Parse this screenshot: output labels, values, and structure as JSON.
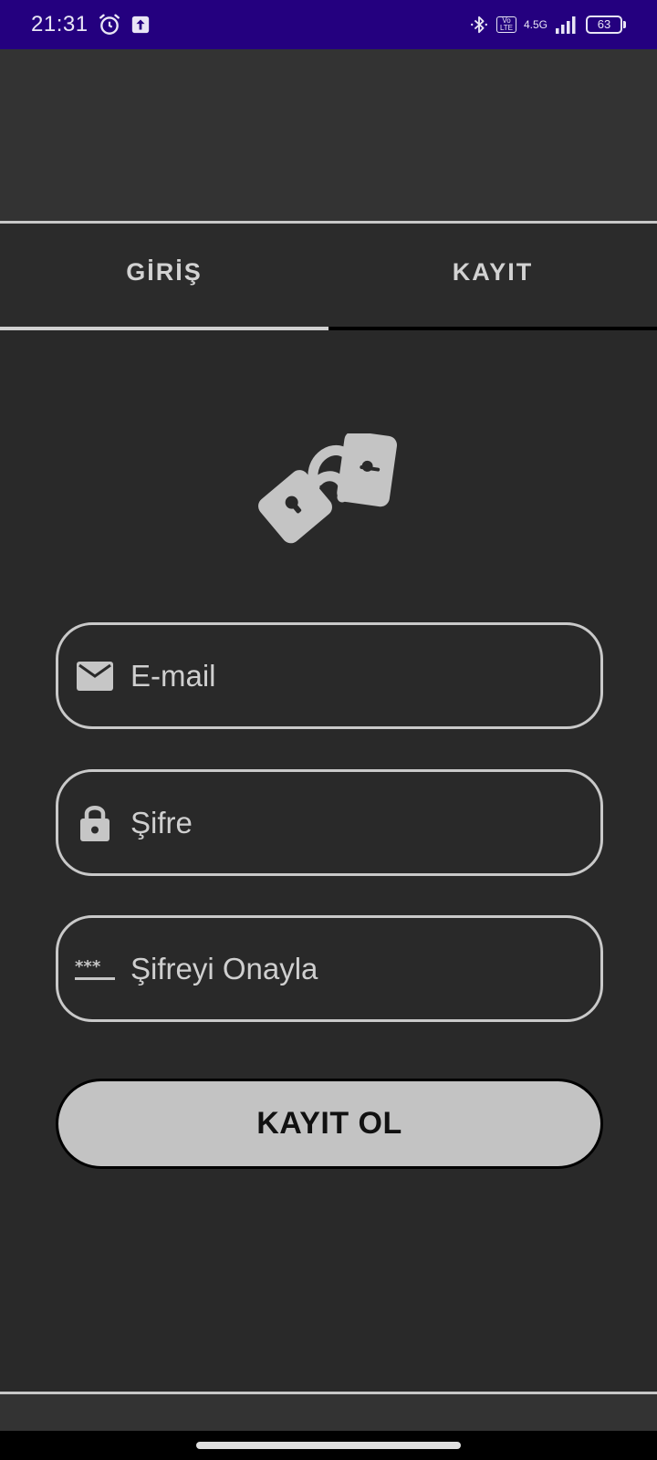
{
  "status_bar": {
    "time": "21:31",
    "left_icons": [
      "alarm-icon",
      "upload-icon"
    ],
    "right_icons": [
      "bluetooth-icon",
      "volte-icon",
      "signal-icon"
    ],
    "volte_label": "Vo LTE",
    "network": "4.5G",
    "battery": "63",
    "background": "#24007f"
  },
  "tabs": [
    {
      "label": "GİRİŞ",
      "active": true
    },
    {
      "label": "KAYIT",
      "active": false
    }
  ],
  "logo": {
    "icon": "padlocks-icon"
  },
  "form": {
    "email": {
      "placeholder": "E-mail",
      "icon": "mail-icon",
      "value": ""
    },
    "password": {
      "placeholder": "Şifre",
      "icon": "lock-icon",
      "value": ""
    },
    "confirm_password": {
      "placeholder": "Şifreyi Onayla",
      "icon": "password-dots-icon",
      "value": ""
    }
  },
  "submit_button": {
    "label": "KAYIT OL"
  },
  "colors": {
    "background": "#292929",
    "app_bar": "#333333",
    "field_border": "#c9c9c9",
    "button_fill": "#c3c3c3",
    "text": "#d0d0d0"
  }
}
